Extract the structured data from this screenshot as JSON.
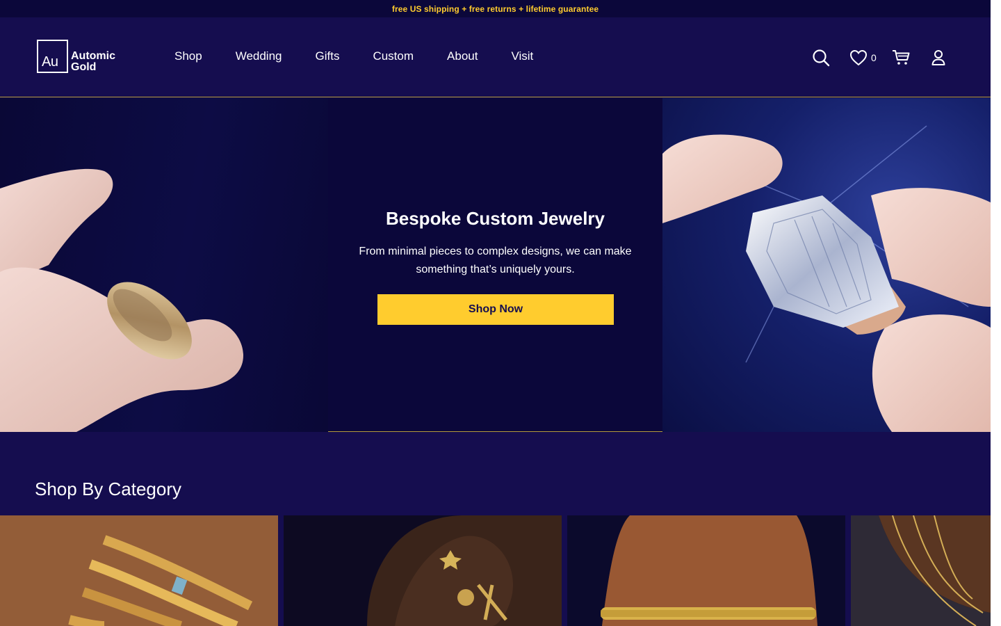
{
  "announcement": {
    "text": "free US shipping + free returns + lifetime guarantee"
  },
  "brand": {
    "mark": "Au",
    "name_line1": "Automic",
    "name_line2": "Gold"
  },
  "nav": {
    "items": [
      {
        "label": "Shop"
      },
      {
        "label": "Wedding"
      },
      {
        "label": "Gifts"
      },
      {
        "label": "Custom"
      },
      {
        "label": "About"
      },
      {
        "label": "Visit"
      }
    ]
  },
  "header_icons": {
    "search": "search-icon",
    "wishlist": "heart-icon",
    "wishlist_count": "0",
    "cart": "cart-icon",
    "account": "user-icon"
  },
  "hero": {
    "title": "Bespoke Custom Jewelry",
    "subtitle": "From minimal pieces to complex designs, we can make something that’s uniquely yours.",
    "cta_label": "Shop Now"
  },
  "category": {
    "title": "Shop By Category"
  },
  "colors": {
    "background": "#150d4f",
    "dark": "#0b073a",
    "accent": "#ffcc2e",
    "divider": "#b59b3a"
  }
}
